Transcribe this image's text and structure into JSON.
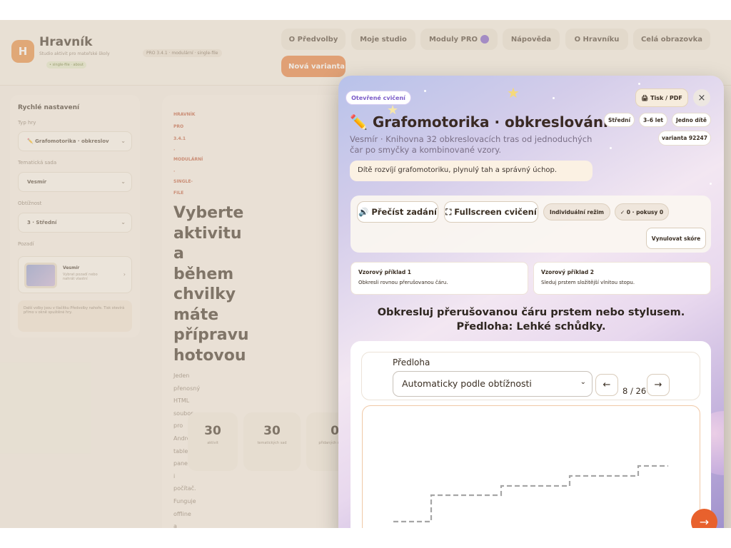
{
  "header": {
    "logo_letter": "H",
    "app_name": "Hravník",
    "subtitle": "Studio aktivit pro mateřské školy",
    "version": "PRO 3.4.1 · modulární · single-file",
    "tag": "• single-file · about",
    "nav": [
      "O Předvolby",
      "Moje studio",
      "Moduly PRO",
      "Nápověda",
      "O Hravníku",
      "Celá obrazovka"
    ],
    "new_variant": "Nová varianta"
  },
  "sidebar": {
    "title": "Rychlé nastavení",
    "type_label": "Typ hry",
    "type_value": "✏️ Grafomotorika · obkreslov",
    "set_label": "Tematická sada",
    "set_value": "Vesmír",
    "difficulty_label": "Obtížnost",
    "difficulty_value": "3 · Střední",
    "bg_label": "Pozadí",
    "bg_name": "Vesmír",
    "bg_desc": "Vybrat pozadí nebo nahrát vlastní",
    "note": "Další volby jsou v tlačítku Předvolby nahoře. Tisk otevírá přímo v okně spuštěné hry."
  },
  "main": {
    "small_lines": [
      "HRAVNÍK",
      "PRO",
      "3.4.1",
      "·",
      "MODULÁRNÍ",
      "·",
      "SINGLE-",
      "FILE"
    ],
    "heading_words": [
      "Vyberte",
      "aktivitu",
      "a",
      "během",
      "chvilky",
      "máte",
      "přípravu",
      "hotovou"
    ],
    "body_words": [
      "Jeden",
      "přenosný",
      "HTML",
      "soubor",
      "pro",
      "Android,",
      "tablet,",
      "panel",
      "i",
      "počítač.",
      "Funguje",
      "offline",
      "a"
    ],
    "stats": [
      {
        "num": "30",
        "text": "aktivit"
      },
      {
        "num": "30",
        "text": "tematických sad"
      },
      {
        "num": "0",
        "text": "přidaných modulů"
      }
    ]
  },
  "modal": {
    "badge": "Otevřené cvičení",
    "print": "🖨 Tisk / PDF",
    "close": "×",
    "title": "✏️ Grafomotorika · obkreslování",
    "pills": [
      "Střední",
      "3–6 let",
      "Jedno dítě"
    ],
    "variant": "varianta 92247",
    "desc": "Vesmír · Knihovna 32 obkreslovacích tras od jednoduchých čar po smyčky a kombinované vzory.",
    "goal": "Dítě rozvíjí grafomotoriku, plynulý tah a správný úchop.",
    "read_btn": "🔊 Přečíst zadání",
    "fullscreen_btn": "⛶ Fullscreen cvičení",
    "mode_pill": "Individuální režim",
    "score_pill": "✓ 0 · pokusy 0",
    "reset_btn": "Vynulovat skóre",
    "examples": [
      {
        "title": "Vzorový příklad 1",
        "text": "Obkresli rovnou přerušovanou čáru."
      },
      {
        "title": "Vzorový příklad 2",
        "text": "Sleduj prstem složitější vlnitou stopu."
      }
    ],
    "instruction": "Obkresluj přerušovanou čáru prstem nebo stylusem. Předloha: Lehké schůdky.",
    "template_label": "Předloha",
    "template_value": "Automaticky podle obtížnosti",
    "prev": "←",
    "next": "→",
    "counter": "8 / 26",
    "fab": "→"
  }
}
